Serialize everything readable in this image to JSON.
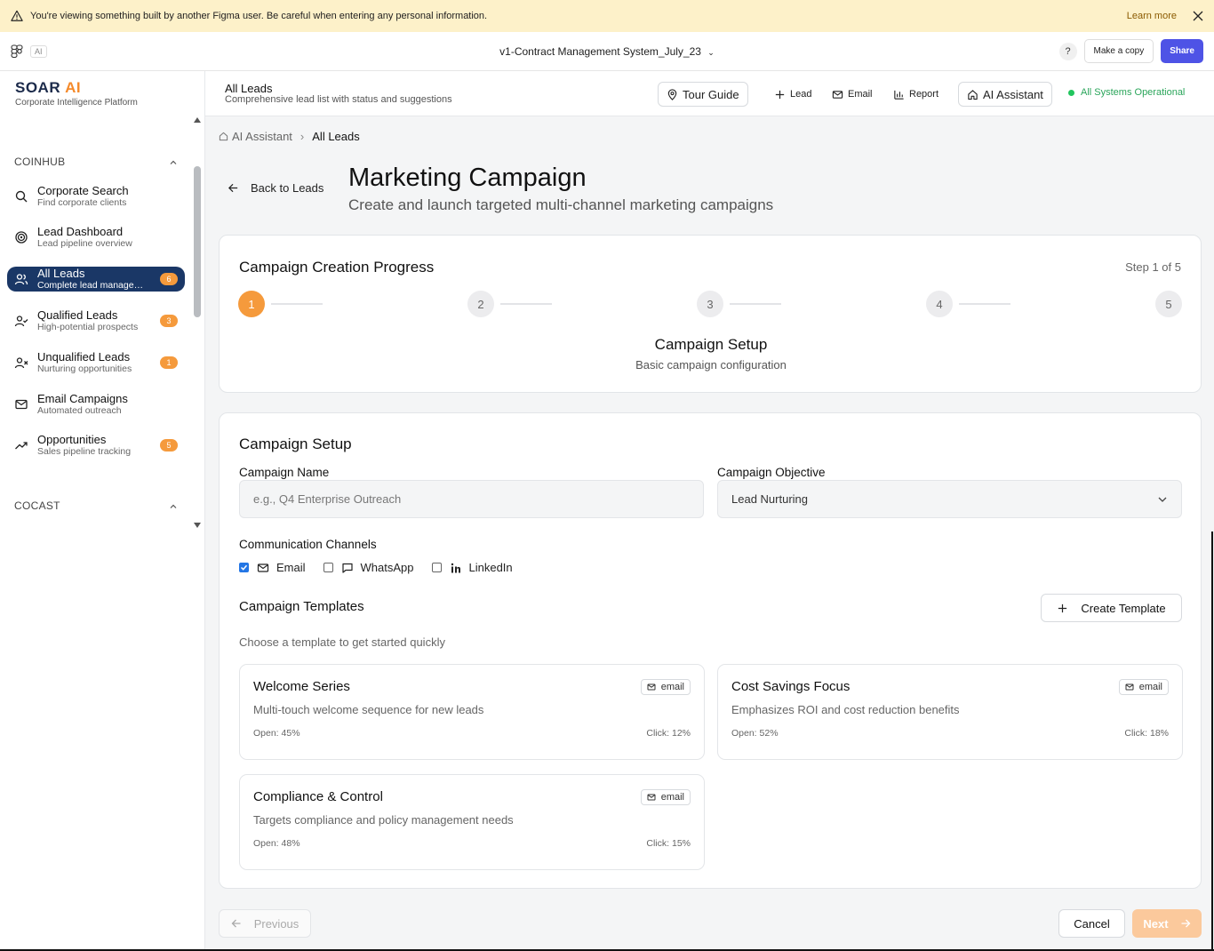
{
  "figma": {
    "banner_text": "You're viewing something built by another Figma user. Be careful when entering any personal information.",
    "learn_more": "Learn more",
    "ai_chip": "AI",
    "file_title": "v1-Contract Management System_July_23",
    "help": "?",
    "make_copy": "Make a copy",
    "share": "Share"
  },
  "brand": {
    "logo_part1": "SOAR",
    "logo_part2": "AI",
    "subtitle": "Corporate Intelligence Platform"
  },
  "sidebar": {
    "section1": "COINHUB",
    "section2": "COCAST",
    "items": [
      {
        "icon": "search-icon",
        "label": "Corporate Search",
        "sub": "Find corporate clients",
        "badge": ""
      },
      {
        "icon": "target-icon",
        "label": "Lead Dashboard",
        "sub": "Lead pipeline overview",
        "badge": ""
      },
      {
        "icon": "users-icon",
        "label": "All Leads",
        "sub": "Complete lead management",
        "badge": "6"
      },
      {
        "icon": "user-check-icon",
        "label": "Qualified Leads",
        "sub": "High-potential prospects",
        "badge": "3"
      },
      {
        "icon": "user-x-icon",
        "label": "Unqualified Leads",
        "sub": "Nurturing opportunities",
        "badge": "1"
      },
      {
        "icon": "mail-icon",
        "label": "Email Campaigns",
        "sub": "Automated outreach",
        "badge": ""
      },
      {
        "icon": "trending-up-icon",
        "label": "Opportunities",
        "sub": "Sales pipeline tracking",
        "badge": "5"
      }
    ]
  },
  "header": {
    "title": "All Leads",
    "subtitle": "Comprehensive lead list with status and suggestions",
    "tour_guide": "Tour Guide",
    "lead": "Lead",
    "email": "Email",
    "report": "Report",
    "ai_assistant": "AI Assistant",
    "status": "All Systems Operational",
    "status_color": "#22c55e"
  },
  "breadcrumb": {
    "home": "AI Assistant",
    "current": "All Leads"
  },
  "page": {
    "back": "Back to Leads",
    "title": "Marketing Campaign",
    "subtitle": "Create and launch targeted multi-channel marketing campaigns"
  },
  "progress": {
    "title": "Campaign Creation Progress",
    "step_of": "Step 1 of 5",
    "steps": [
      "1",
      "2",
      "3",
      "4",
      "5"
    ],
    "current_step": 1,
    "stage_name": "Campaign Setup",
    "stage_sub": "Basic campaign configuration",
    "accent": "#f59a3c"
  },
  "setup": {
    "title": "Campaign Setup",
    "name_label": "Campaign Name",
    "name_placeholder": "e.g., Q4 Enterprise Outreach",
    "objective_label": "Campaign Objective",
    "objective_value": "Lead Nurturing",
    "channels_label": "Communication Channels",
    "channels": [
      {
        "label": "Email",
        "checked": true,
        "icon": "mail-icon"
      },
      {
        "label": "WhatsApp",
        "checked": false,
        "icon": "message-square-icon"
      },
      {
        "label": "LinkedIn",
        "checked": false,
        "icon": "linkedin-icon"
      }
    ],
    "templates_title": "Campaign Templates",
    "templates_sub": "Choose a template to get started quickly",
    "create_template": "Create Template",
    "templates": [
      {
        "name": "Welcome Series",
        "desc": "Multi-touch welcome sequence for new leads",
        "tag": "email",
        "open": "Open: 45%",
        "click": "Click: 12%"
      },
      {
        "name": "Cost Savings Focus",
        "desc": "Emphasizes ROI and cost reduction benefits",
        "tag": "email",
        "open": "Open: 52%",
        "click": "Click: 18%"
      },
      {
        "name": "Compliance & Control",
        "desc": "Targets compliance and policy management needs",
        "tag": "email",
        "open": "Open: 48%",
        "click": "Click: 15%"
      }
    ]
  },
  "footer": {
    "previous": "Previous",
    "cancel": "Cancel",
    "next": "Next"
  }
}
